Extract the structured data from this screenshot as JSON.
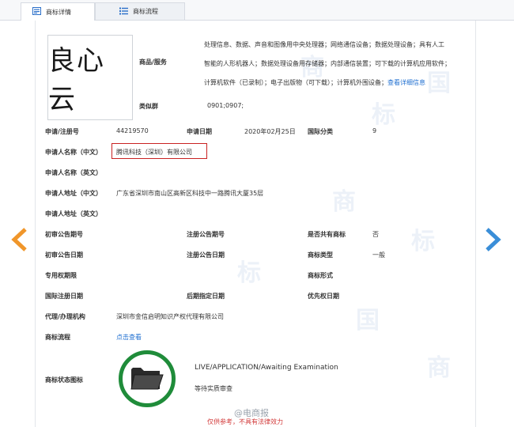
{
  "tabs": [
    {
      "label": "商标详情",
      "icon": "document-icon",
      "active": true
    },
    {
      "label": "商标流程",
      "icon": "list-icon",
      "active": false
    }
  ],
  "logo_text": "良心云",
  "goods_services": {
    "label": "商品/服务",
    "lines": [
      "处理信息、数据、声音和图像用中央处理器；网络通信设备；数据处理设备；具有人工",
      "智能的人形机器人；数据处理设备用存储器；内部通信装置；可下载的计算机应用软件；",
      "计算机软件（已录制）；电子出版物（可下载）；计算机外围设备；"
    ],
    "more_link": "查看详细信息"
  },
  "similar_group": {
    "label": "类似群",
    "value": "0901;0907;"
  },
  "fields": {
    "reg_no": {
      "label": "申请/注册号",
      "value": "44219570"
    },
    "app_date": {
      "label": "申请日期",
      "value": "2020年02月25日"
    },
    "intl_class": {
      "label": "国际分类",
      "value": "9"
    },
    "applicant_cn": {
      "label": "申请人名称（中文）",
      "value": "腾讯科技（深圳）有限公司"
    },
    "applicant_en": {
      "label": "申请人名称（英文）",
      "value": ""
    },
    "address_cn": {
      "label": "申请人地址（中文）",
      "value": "广东省深圳市南山区高新区科技中一路腾讯大厦35层"
    },
    "address_en": {
      "label": "申请人地址（英文）",
      "value": ""
    },
    "prelim_issue": {
      "label": "初审公告期号",
      "value": ""
    },
    "reg_issue": {
      "label": "注册公告期号",
      "value": ""
    },
    "shared": {
      "label": "是否共有商标",
      "value": "否"
    },
    "prelim_date": {
      "label": "初审公告日期",
      "value": ""
    },
    "reg_date": {
      "label": "注册公告日期",
      "value": ""
    },
    "tm_type": {
      "label": "商标类型",
      "value": "一般"
    },
    "exclusive": {
      "label": "专用权期限",
      "value": ""
    },
    "tm_form": {
      "label": "商标形式",
      "value": ""
    },
    "intl_reg_date": {
      "label": "国际注册日期",
      "value": ""
    },
    "later_date": {
      "label": "后期指定日期",
      "value": ""
    },
    "priority_date": {
      "label": "优先权日期",
      "value": ""
    },
    "agent": {
      "label": "代理/办理机构",
      "value": "深圳市金信启明知识产权代理有限公司"
    },
    "process": {
      "label": "商标流程",
      "value": "点击查看"
    }
  },
  "status": {
    "label": "商标状态图标",
    "en": "LIVE/APPLICATION/Awaiting Examination",
    "cn": "等待实质审查",
    "icon": "folder-icon",
    "ring_color": "#1f8c3a"
  },
  "watermark": "@电商报",
  "footer_note": "仅供参考，不具有法律效力",
  "nav": {
    "prev_icon": "arrow-left-icon",
    "next_icon": "arrow-right-icon",
    "prev_color": "#f0962a",
    "next_color": "#3a8ed8"
  }
}
